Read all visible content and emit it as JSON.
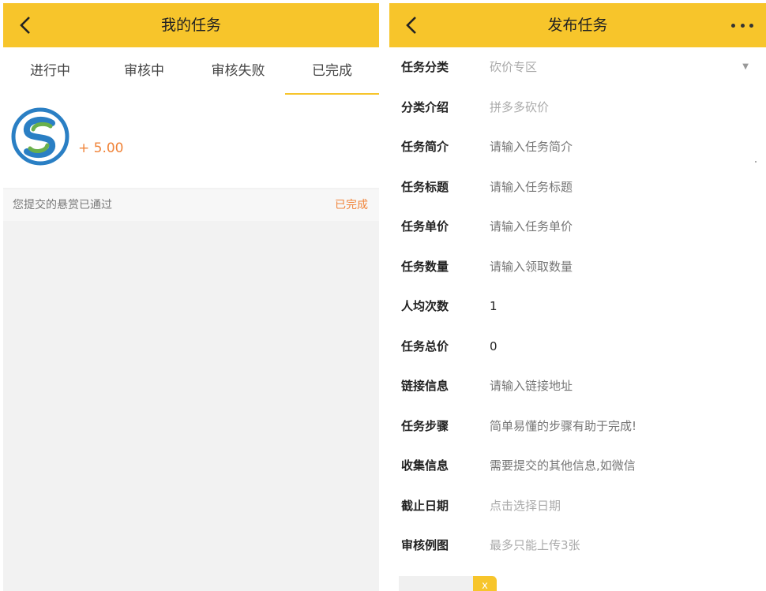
{
  "left": {
    "title": "我的任务",
    "tabs": [
      "进行中",
      "审核中",
      "审核失败",
      "已完成"
    ],
    "card": {
      "reward": "+ 5.00",
      "message": "您提交的悬赏已通过",
      "status": "已完成"
    }
  },
  "right": {
    "title": "发布任务",
    "fields": [
      {
        "label": "任务分类",
        "value": "砍价专区"
      },
      {
        "label": "分类介绍",
        "value": "拼多多砍价"
      },
      {
        "label": "任务简介",
        "placeholder": "请输入任务简介"
      },
      {
        "label": "任务标题",
        "placeholder": "请输入任务标题"
      },
      {
        "label": "任务单价",
        "placeholder": "请输入任务单价"
      },
      {
        "label": "任务数量",
        "placeholder": "请输入领取数量"
      },
      {
        "label": "人均次数",
        "value": "1"
      },
      {
        "label": "任务总价",
        "value": "0"
      },
      {
        "label": "链接信息",
        "placeholder": "请输入链接地址"
      },
      {
        "label": "任务步骤",
        "placeholder": "简单易懂的步骤有助于完成!"
      },
      {
        "label": "收集信息",
        "placeholder": "需要提交的其他信息,如微信"
      },
      {
        "label": "截止日期",
        "value": "点击选择日期"
      },
      {
        "label": "审核例图",
        "value": "最多只能上传3张"
      }
    ],
    "upload_remove": "x"
  },
  "colors": {
    "header": "#f7c52b",
    "accent": "#f0843a"
  },
  "icons": [
    "back-icon",
    "more-icon",
    "app-logo-icon",
    "dropdown-caret-icon"
  ]
}
